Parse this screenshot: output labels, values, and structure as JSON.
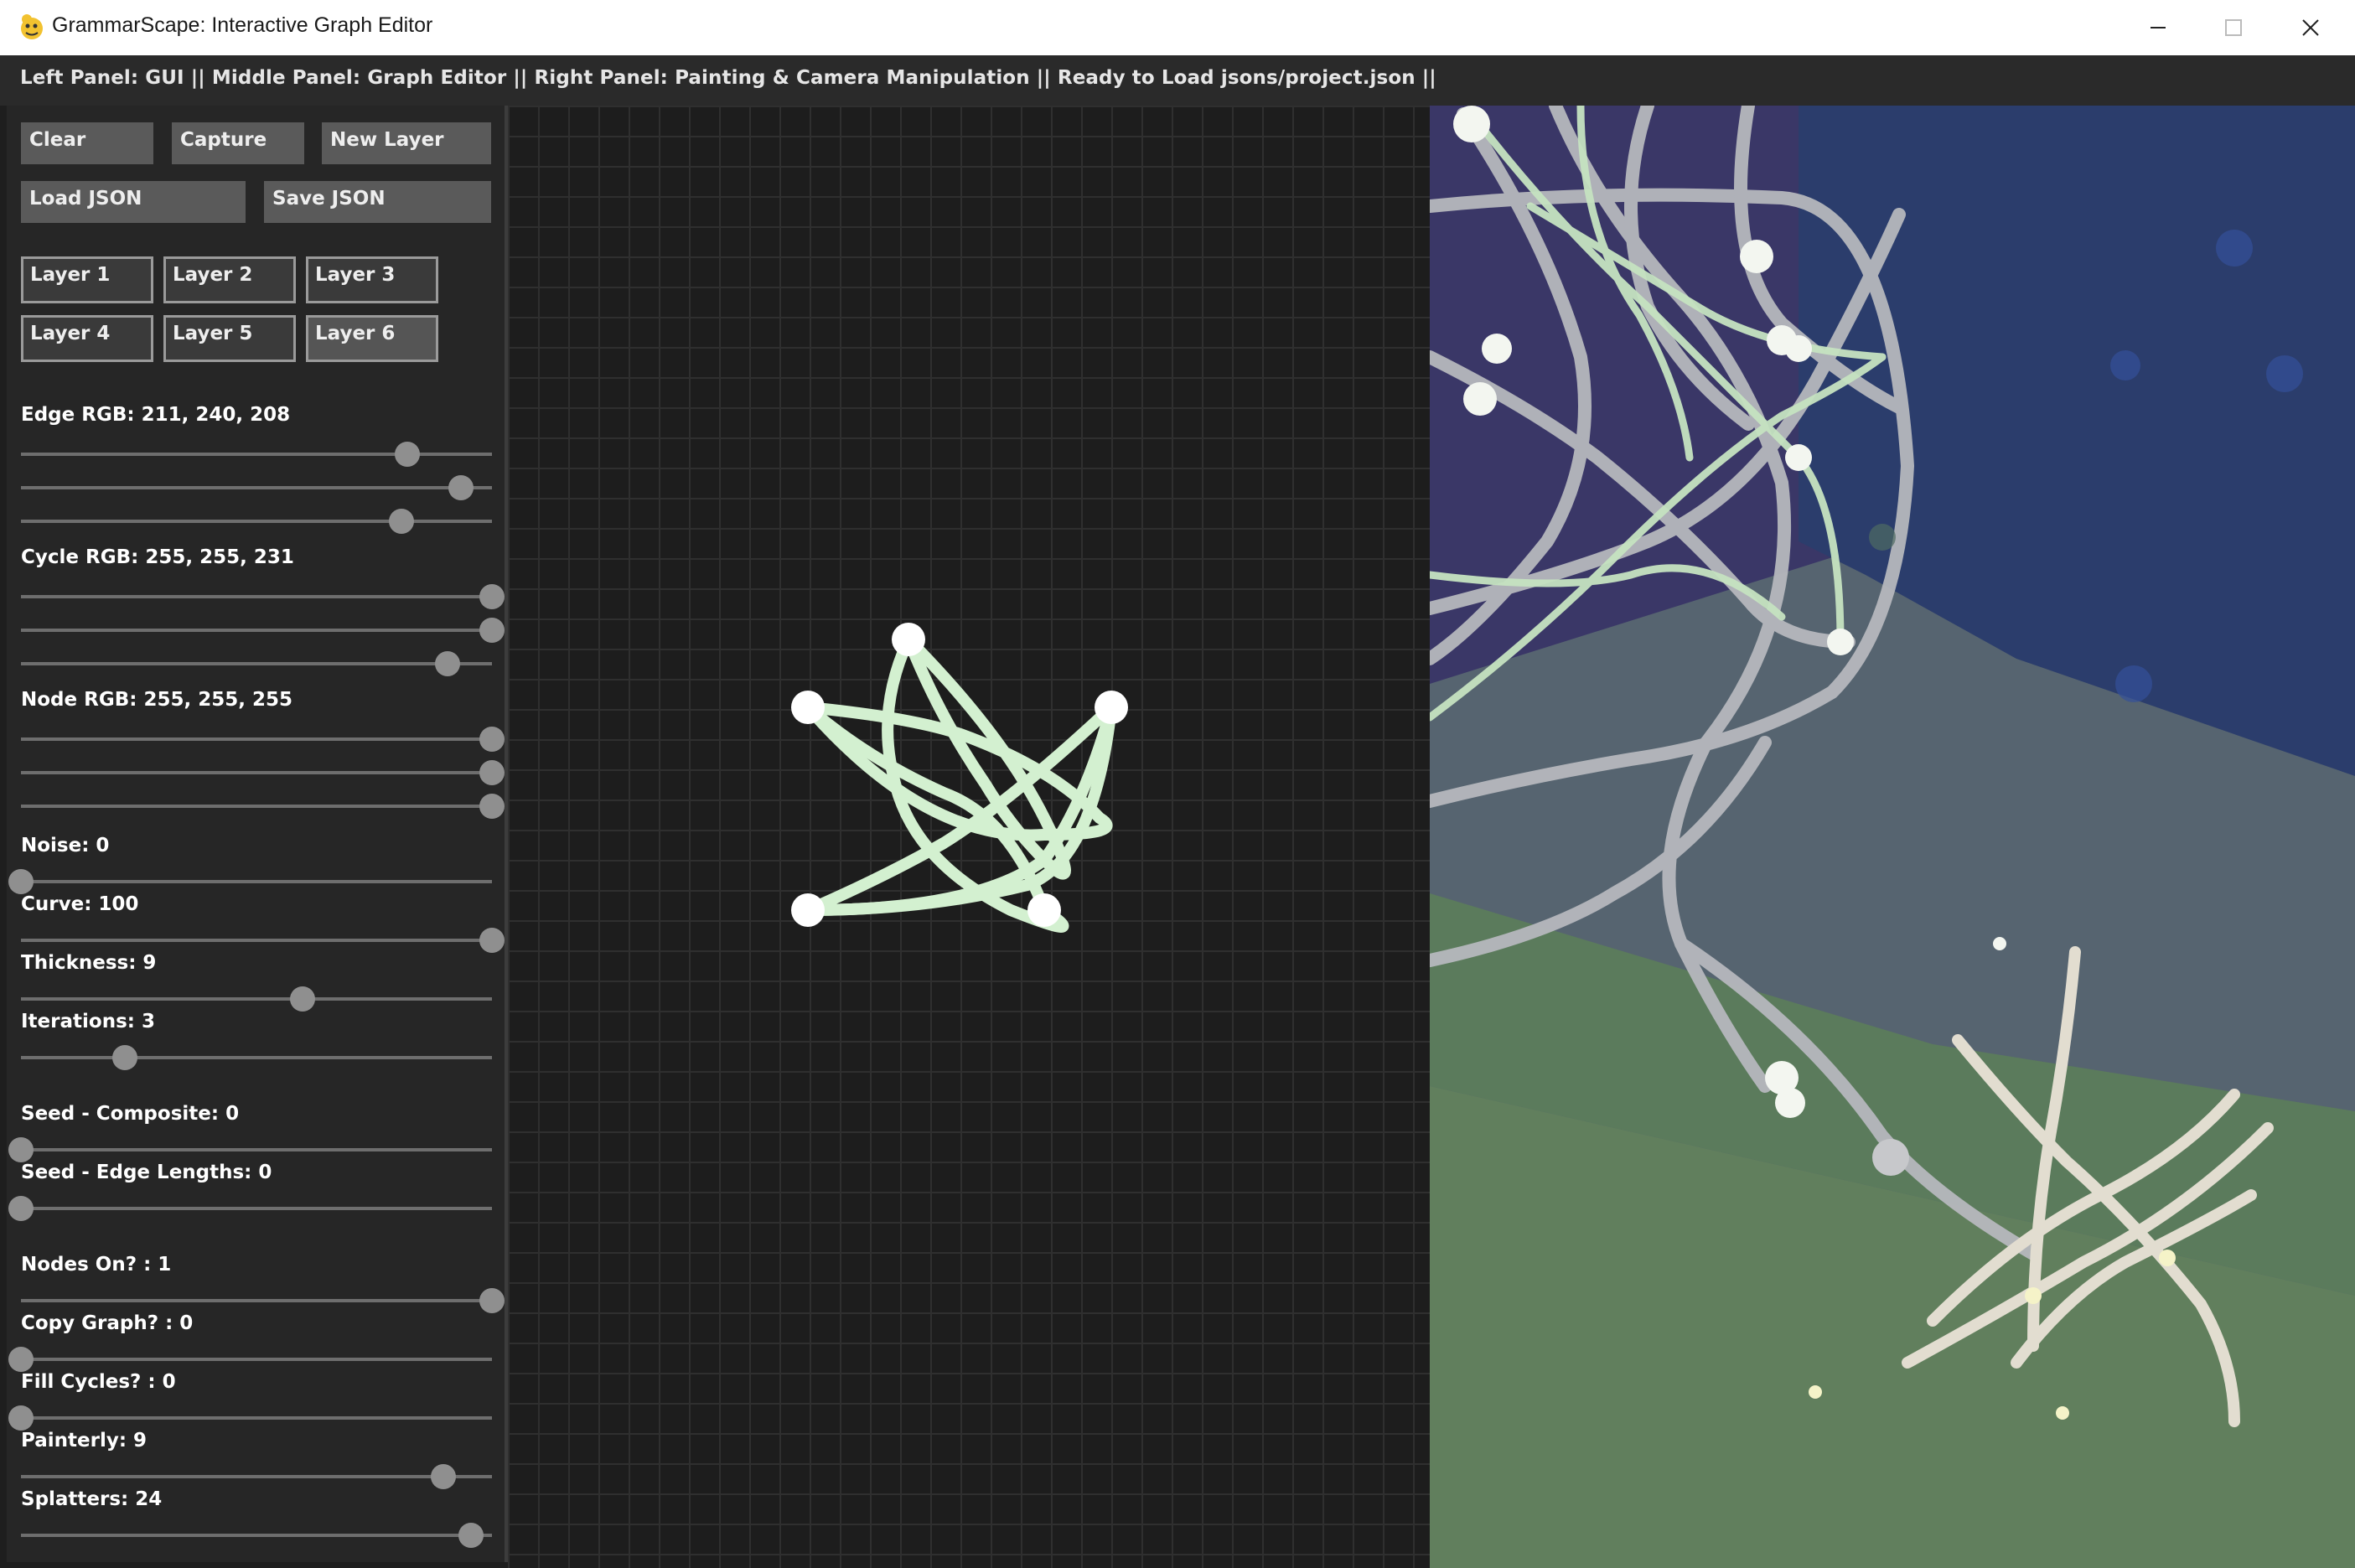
{
  "window": {
    "title": "GrammarScape: Interactive Graph Editor"
  },
  "status_bar": {
    "text": "Left Panel: GUI || Middle Panel: Graph Editor ||  Right Panel: Painting & Camera Manipulation || Ready to Load jsons/project.json ||"
  },
  "toolbar": {
    "clear_label": "Clear",
    "capture_label": "Capture",
    "new_layer_label": "New Layer",
    "load_json_label": "Load JSON",
    "save_json_label": "Save JSON"
  },
  "layers": [
    "Layer 1",
    "Layer 2",
    "Layer 3",
    "Layer 4",
    "Layer 5",
    "Layer 6"
  ],
  "active_layer": "Layer 6",
  "controls": {
    "edge_rgb": "Edge RGB: 211, 240, 208",
    "cycle_rgb": "Cycle RGB: 255, 255, 231",
    "node_rgb": "Node RGB: 255, 255, 255",
    "noise": "Noise: 0",
    "curve": "Curve: 100",
    "thickness": "Thickness: 9",
    "iterations": "Iterations: 3",
    "seed_composite": "Seed - Composite: 0",
    "seed_edge_lengths": "Seed - Edge Lengths: 0",
    "nodes_on": "Nodes On? : 1",
    "copy_graph": "Copy Graph? : 0",
    "fill_cycles": "Fill Cycles? : 0",
    "painterly": "Painterly: 9",
    "splatters": "Splatters: 24"
  },
  "colors": {
    "edge": "#d3f0d0",
    "cycle": "#ffffe7",
    "node": "#ffffff",
    "panel_bg": "#262626",
    "editor_bg": "#1d1d1d"
  },
  "icons": [
    "app-icon",
    "minimize-icon",
    "maximize-icon",
    "close-icon"
  ]
}
